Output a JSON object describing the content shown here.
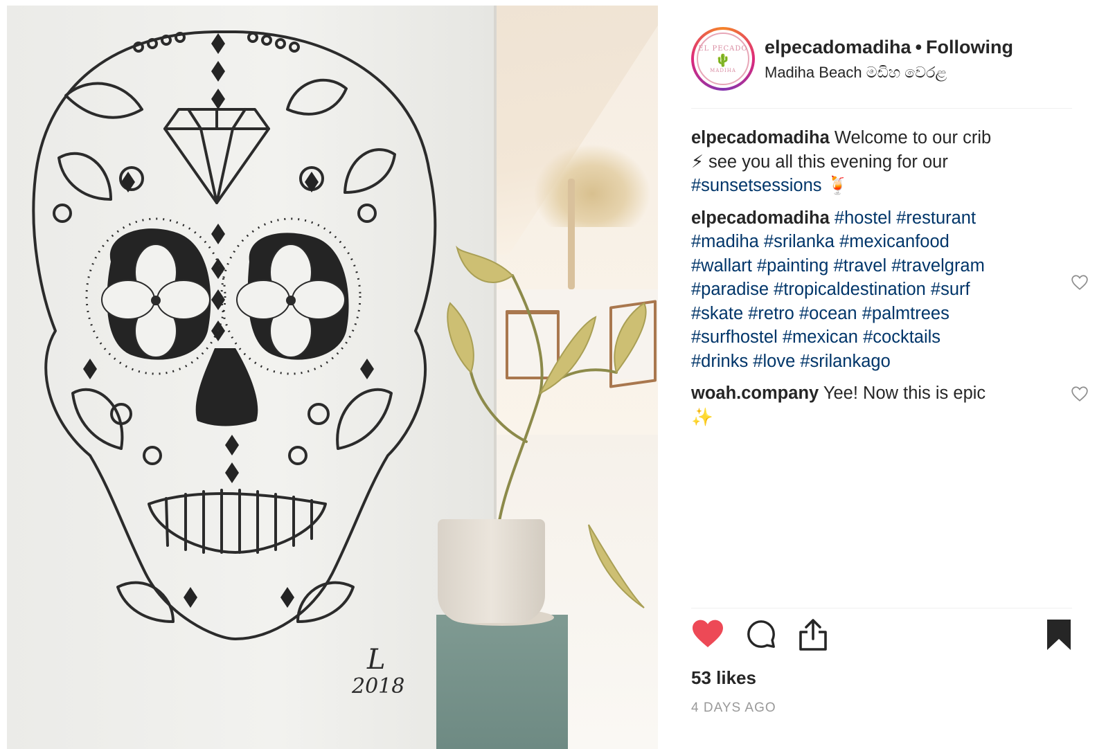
{
  "header": {
    "username": "elpecadomadiha",
    "separator": "•",
    "follow_status": "Following",
    "location": "Madiha Beach මඩිහ වෙරළ",
    "avatar": {
      "top_text": "EL PECADO",
      "bottom_text": "MADIHA",
      "icon": "cactus-icon"
    }
  },
  "media": {
    "signature_mark": "L",
    "signature_year": "2018"
  },
  "comments": [
    {
      "user": "elpecadomadiha",
      "line1": "Welcome to our crib",
      "line2": "⚡ see you all this evening for our",
      "line3_tag": "#sunsetsessions",
      "line3_emoji": "🍹"
    },
    {
      "user": "elpecadomadiha",
      "tags": [
        [
          "#hostel",
          "#resturant"
        ],
        [
          "#madiha",
          "#srilanka",
          "#mexicanfood"
        ],
        [
          "#wallart",
          "#painting",
          "#travel",
          "#travelgram"
        ],
        [
          "#paradise",
          "#tropicaldestination",
          "#surf"
        ],
        [
          "#skate",
          "#retro",
          "#ocean",
          "#palmtrees"
        ],
        [
          "#surfhostel",
          "#mexican",
          "#cocktails"
        ],
        [
          "#drinks",
          "#love",
          "#srilankago"
        ]
      ]
    },
    {
      "user": "woah.company",
      "text": "Yee! Now this is epic",
      "emoji": "✨"
    }
  ],
  "actions": {
    "like_icon": "heart-filled-icon",
    "comment_icon": "comment-bubble-icon",
    "share_icon": "share-upload-icon",
    "save_icon": "bookmark-filled-icon",
    "like_color": "#ed4956"
  },
  "likes": "53 likes",
  "timestamp": "4 DAYS AGO",
  "colors": {
    "hashtag": "#003569",
    "text": "#262626",
    "muted": "#999999",
    "divider": "#efefef"
  }
}
